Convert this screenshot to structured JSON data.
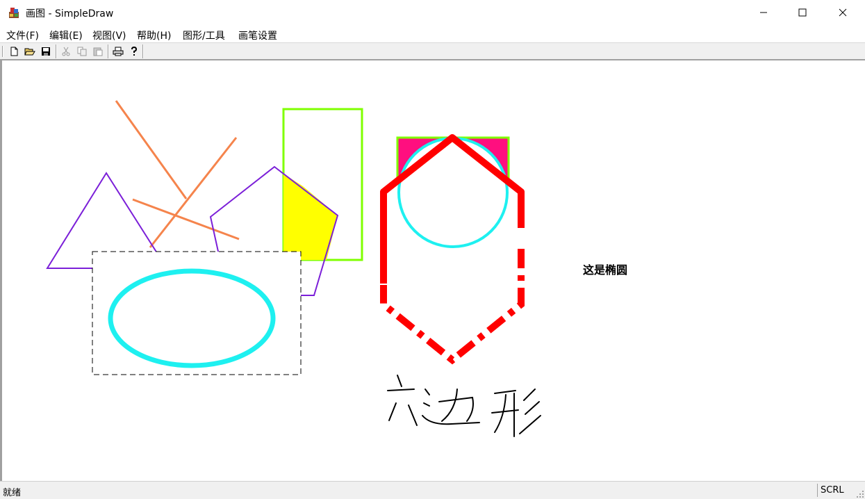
{
  "window": {
    "title": "画图 - SimpleDraw",
    "icon": "paint-app-icon"
  },
  "menu": [
    {
      "label": "文件(F)"
    },
    {
      "label": "编辑(E)"
    },
    {
      "label": "视图(V)"
    },
    {
      "label": "帮助(H)"
    },
    {
      "label": "图形/工具"
    },
    {
      "label": "画笔设置"
    }
  ],
  "toolbar": {
    "buttons": [
      "new-icon",
      "open-icon",
      "save-icon",
      "cut-icon",
      "copy-icon",
      "paste-icon",
      "print-icon",
      "help-icon"
    ]
  },
  "canvas": {
    "ellipse_caption": "这是椭圆",
    "handwriting": "六边形",
    "colors": {
      "line": "#f5844c",
      "triangle": "#7b1fd8",
      "pentagon": "#7b1fd8",
      "rect_outline": "#7fff00",
      "pentagon_fill": "#ffff00",
      "square_fill": "#ff0f7f",
      "circle": "#1ef0f0",
      "ellipse": "#1ef0f0",
      "hexagon": "#ff0000",
      "dashed_box": "#000000"
    }
  },
  "status": {
    "text": "就绪",
    "scrl": "SCRL"
  }
}
